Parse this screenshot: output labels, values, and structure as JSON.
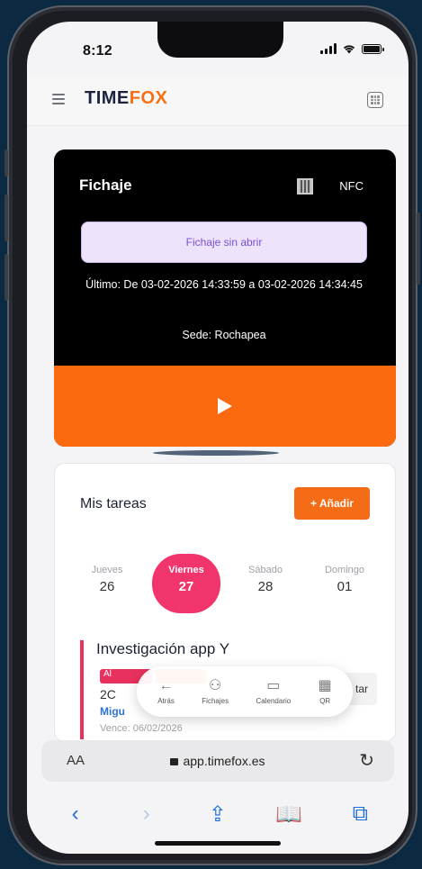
{
  "status": {
    "time": "8:12"
  },
  "brand": {
    "name_part1": "TIME",
    "name_part2": "FOX"
  },
  "fichaje": {
    "title": "Fichaje",
    "nfc_label": "NFC",
    "status_text": "Fichaje sin abrir",
    "last_text": "Último: De 03-02-2026 14:33:59 a 03-02-2026 14:34:45",
    "sede_text": "Sede: Rochapea"
  },
  "tareas": {
    "title": "Mis tareas",
    "add_label": "+ Añadir",
    "days": [
      {
        "name": "Jueves",
        "num": "26"
      },
      {
        "name": "Viernes",
        "num": "27"
      },
      {
        "name": "Sábado",
        "num": "28"
      },
      {
        "name": "Domingo",
        "num": "01"
      }
    ],
    "task": {
      "name": "Investigación app Y",
      "tag1": "Al",
      "code": "2C",
      "user": "Migu",
      "vence": "Vence: 06/02/2026",
      "button_label": "tar"
    }
  },
  "floatnav": {
    "items": [
      {
        "icon": "←",
        "label": "Atrás"
      },
      {
        "icon": "⚇",
        "label": "Fichajes"
      },
      {
        "icon": "▭",
        "label": "Calendario"
      },
      {
        "icon": "▦",
        "label": "QR"
      }
    ]
  },
  "browser": {
    "aa_label": "AA",
    "url": "app.timefox.es",
    "toolbar_icons": {
      "back": "‹",
      "forward": "›",
      "share": "⇪",
      "bookmarks": "📖",
      "tabs": "⧉",
      "reload": "↻"
    }
  },
  "colors": {
    "accent": "#f46c15",
    "active_day": "#f1346c",
    "link": "#2b74d6"
  }
}
